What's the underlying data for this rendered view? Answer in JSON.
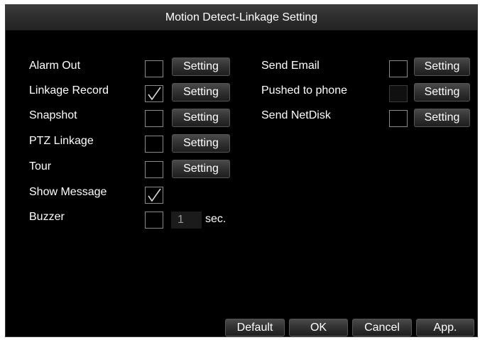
{
  "dialog": {
    "title": "Motion Detect-Linkage Setting"
  },
  "left_column": [
    {
      "label": "Alarm Out",
      "checked": false,
      "button": "Setting"
    },
    {
      "label": "Linkage Record",
      "checked": true,
      "button": "Setting"
    },
    {
      "label": "Snapshot",
      "checked": false,
      "button": "Setting"
    },
    {
      "label": "PTZ Linkage",
      "checked": false,
      "button": "Setting"
    },
    {
      "label": "Tour",
      "checked": false,
      "button": "Setting"
    },
    {
      "label": "Show Message",
      "checked": true
    },
    {
      "label": "Buzzer",
      "checked": false
    }
  ],
  "buzzer": {
    "value": "1",
    "unit": "sec."
  },
  "right_column": [
    {
      "label": "Send Email",
      "checked": false,
      "button": "Setting"
    },
    {
      "label": "Pushed to phone",
      "checked": false,
      "disabled": true,
      "button": "Setting"
    },
    {
      "label": "Send NetDisk",
      "checked": false,
      "button": "Setting"
    }
  ],
  "footer": {
    "default_label": "Default",
    "ok_label": "OK",
    "cancel_label": "Cancel",
    "apply_label": "App."
  },
  "icons": {
    "check": "checkmark-icon"
  }
}
